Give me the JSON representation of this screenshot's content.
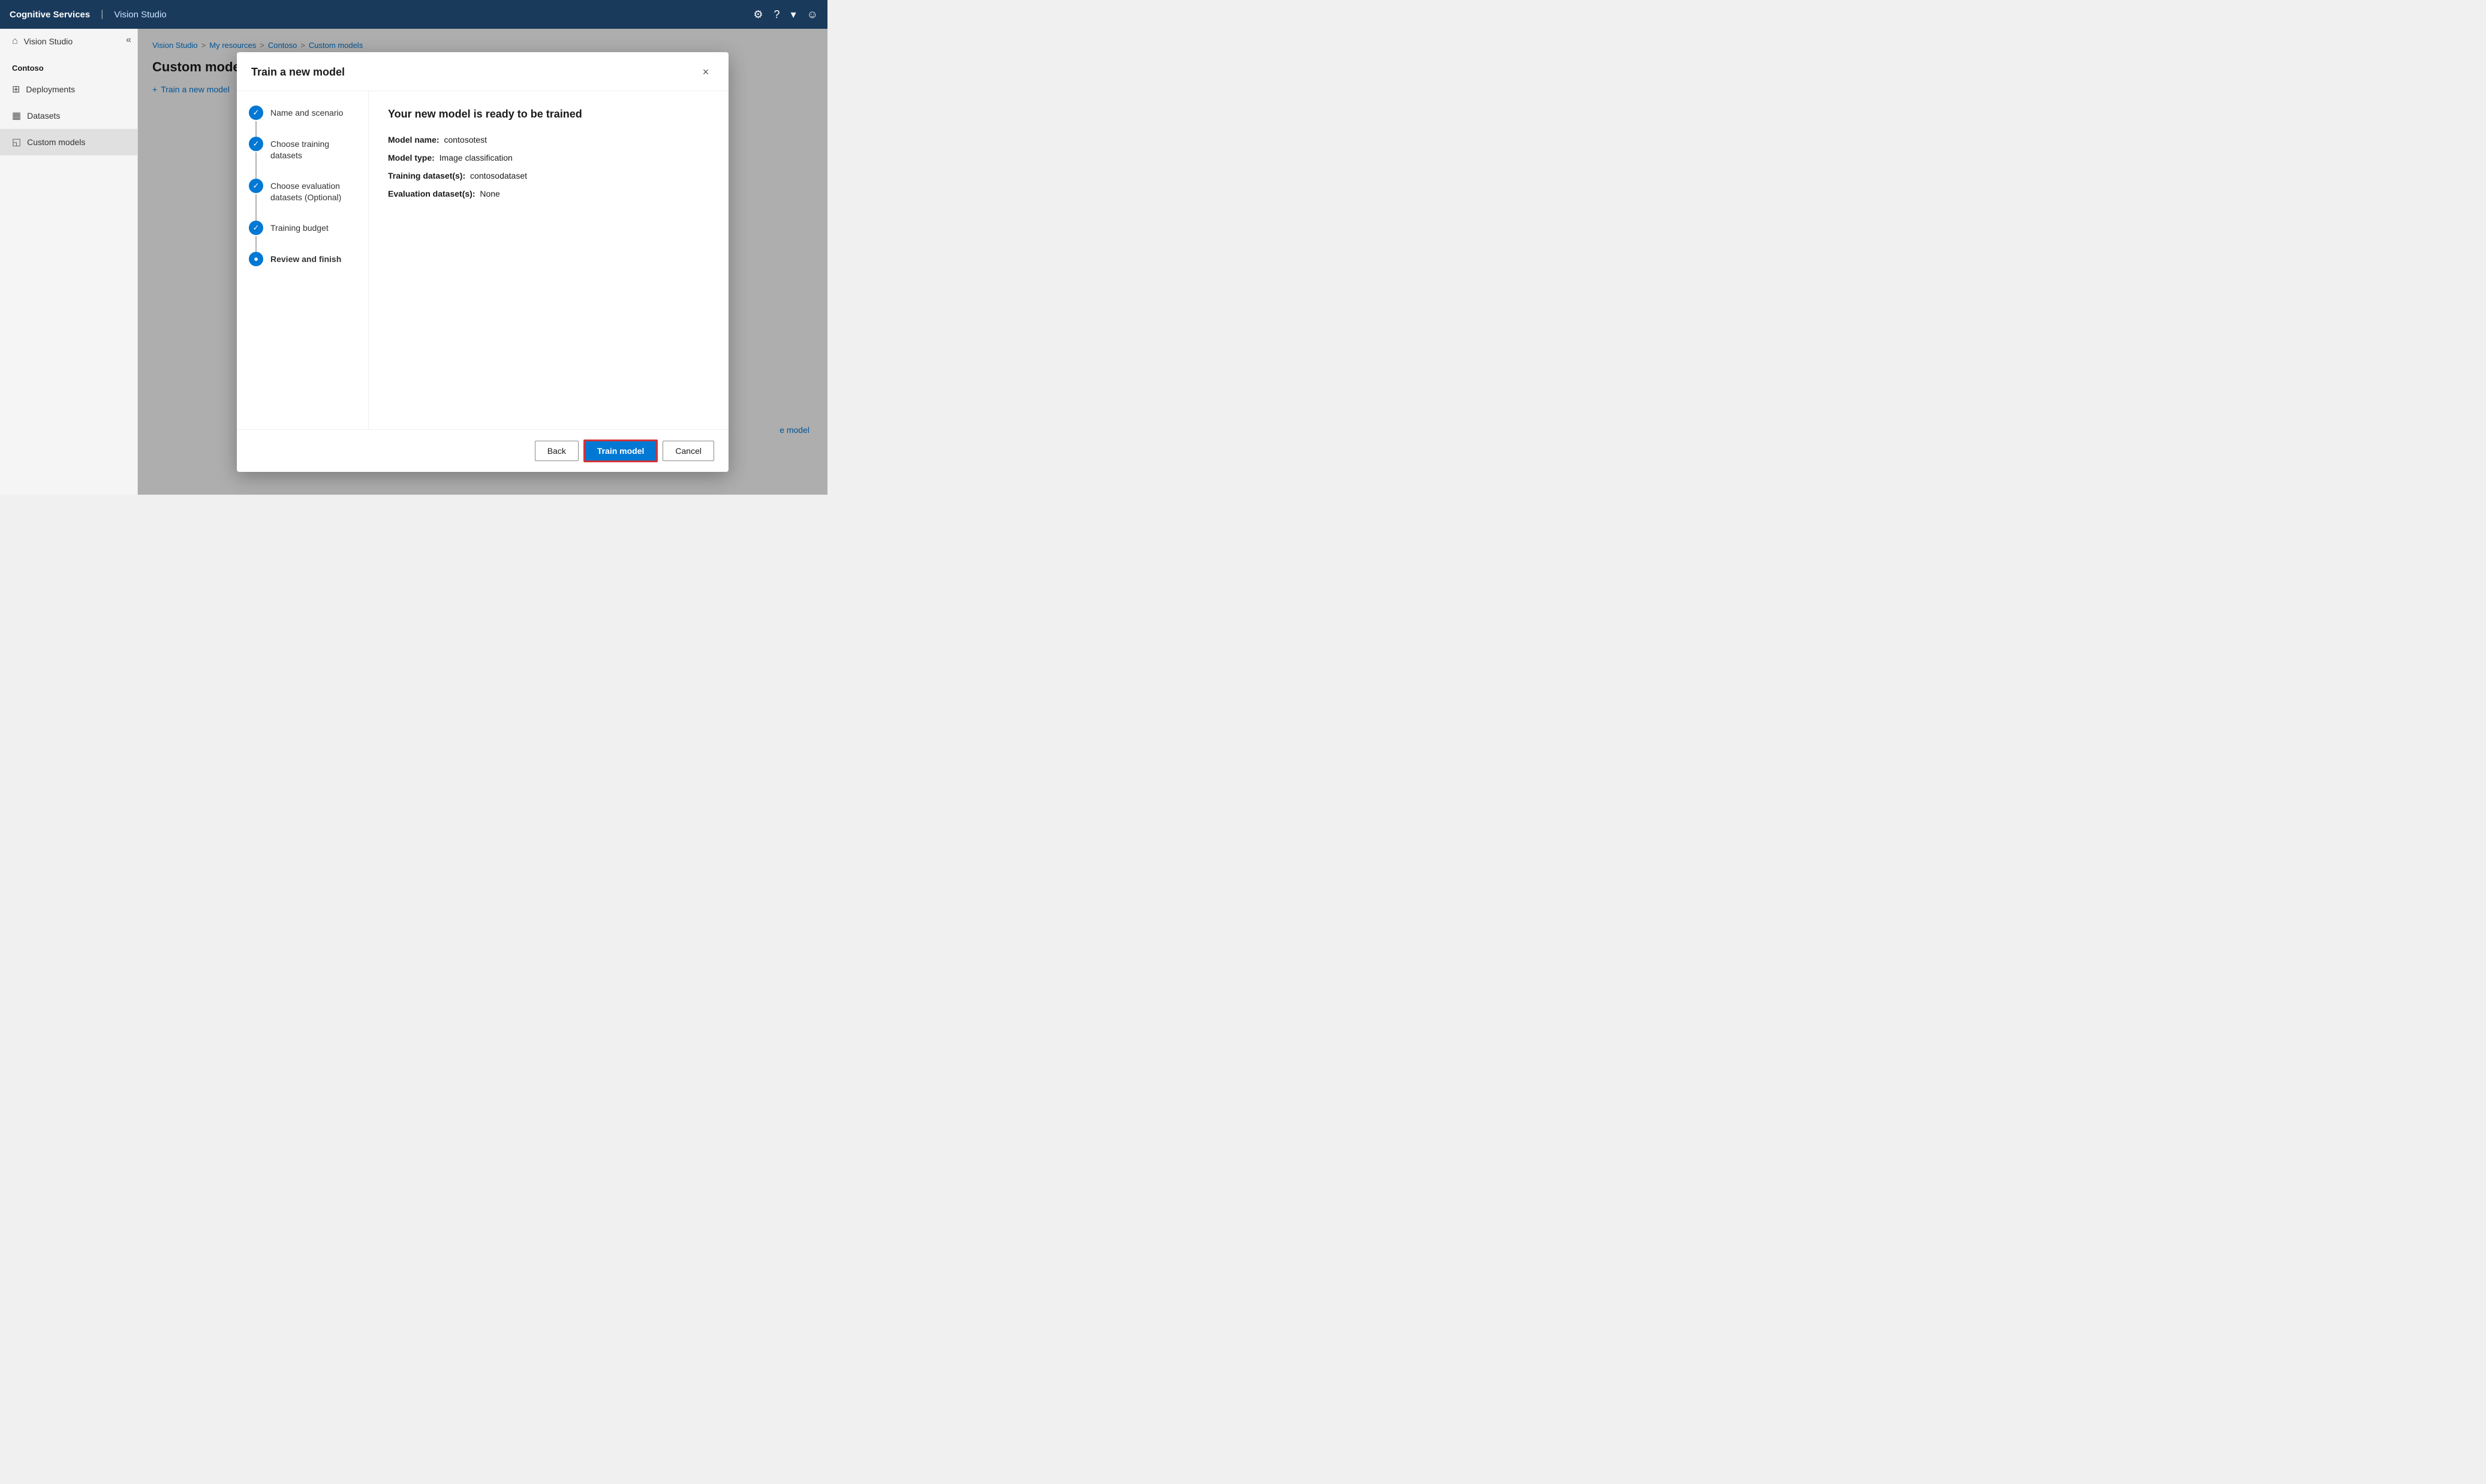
{
  "topbar": {
    "brand": "Cognitive Services",
    "divider": "|",
    "app_name": "Vision Studio",
    "icons": [
      "gear",
      "help",
      "chevron-down",
      "account"
    ]
  },
  "sidebar": {
    "collapse_icon": "«",
    "nav_home": "Vision Studio",
    "section_label": "Contoso",
    "nav_items": [
      {
        "id": "deployments",
        "label": "Deployments",
        "icon": "⊞"
      },
      {
        "id": "datasets",
        "label": "Datasets",
        "icon": "▦"
      },
      {
        "id": "custom-models",
        "label": "Custom models",
        "icon": "◱",
        "active": true
      }
    ]
  },
  "breadcrumb": {
    "items": [
      "Vision Studio",
      "My resources",
      "Contoso",
      "Custom models"
    ],
    "separators": [
      ">",
      ">",
      ">"
    ]
  },
  "page": {
    "title": "Custom models",
    "train_button": "Train a new model"
  },
  "modal": {
    "title": "Train a new model",
    "close_label": "×",
    "steps": [
      {
        "id": "name-scenario",
        "label": "Name and scenario",
        "status": "completed"
      },
      {
        "id": "training-datasets",
        "label": "Choose training datasets",
        "status": "completed"
      },
      {
        "id": "evaluation-datasets",
        "label": "Choose evaluation datasets (Optional)",
        "status": "completed"
      },
      {
        "id": "training-budget",
        "label": "Training budget",
        "status": "completed"
      },
      {
        "id": "review-finish",
        "label": "Review and finish",
        "status": "active"
      }
    ],
    "review": {
      "heading": "Your new model is ready to be trained",
      "fields": [
        {
          "label": "Model name:",
          "value": "contosotest"
        },
        {
          "label": "Model type:",
          "value": "Image classification"
        },
        {
          "label": "Training dataset(s):",
          "value": "contosodataset"
        },
        {
          "label": "Evaluation dataset(s):",
          "value": "None"
        }
      ]
    },
    "footer": {
      "back_label": "Back",
      "train_label": "Train model",
      "cancel_label": "Cancel"
    }
  },
  "background": {
    "link_text": "e model"
  }
}
